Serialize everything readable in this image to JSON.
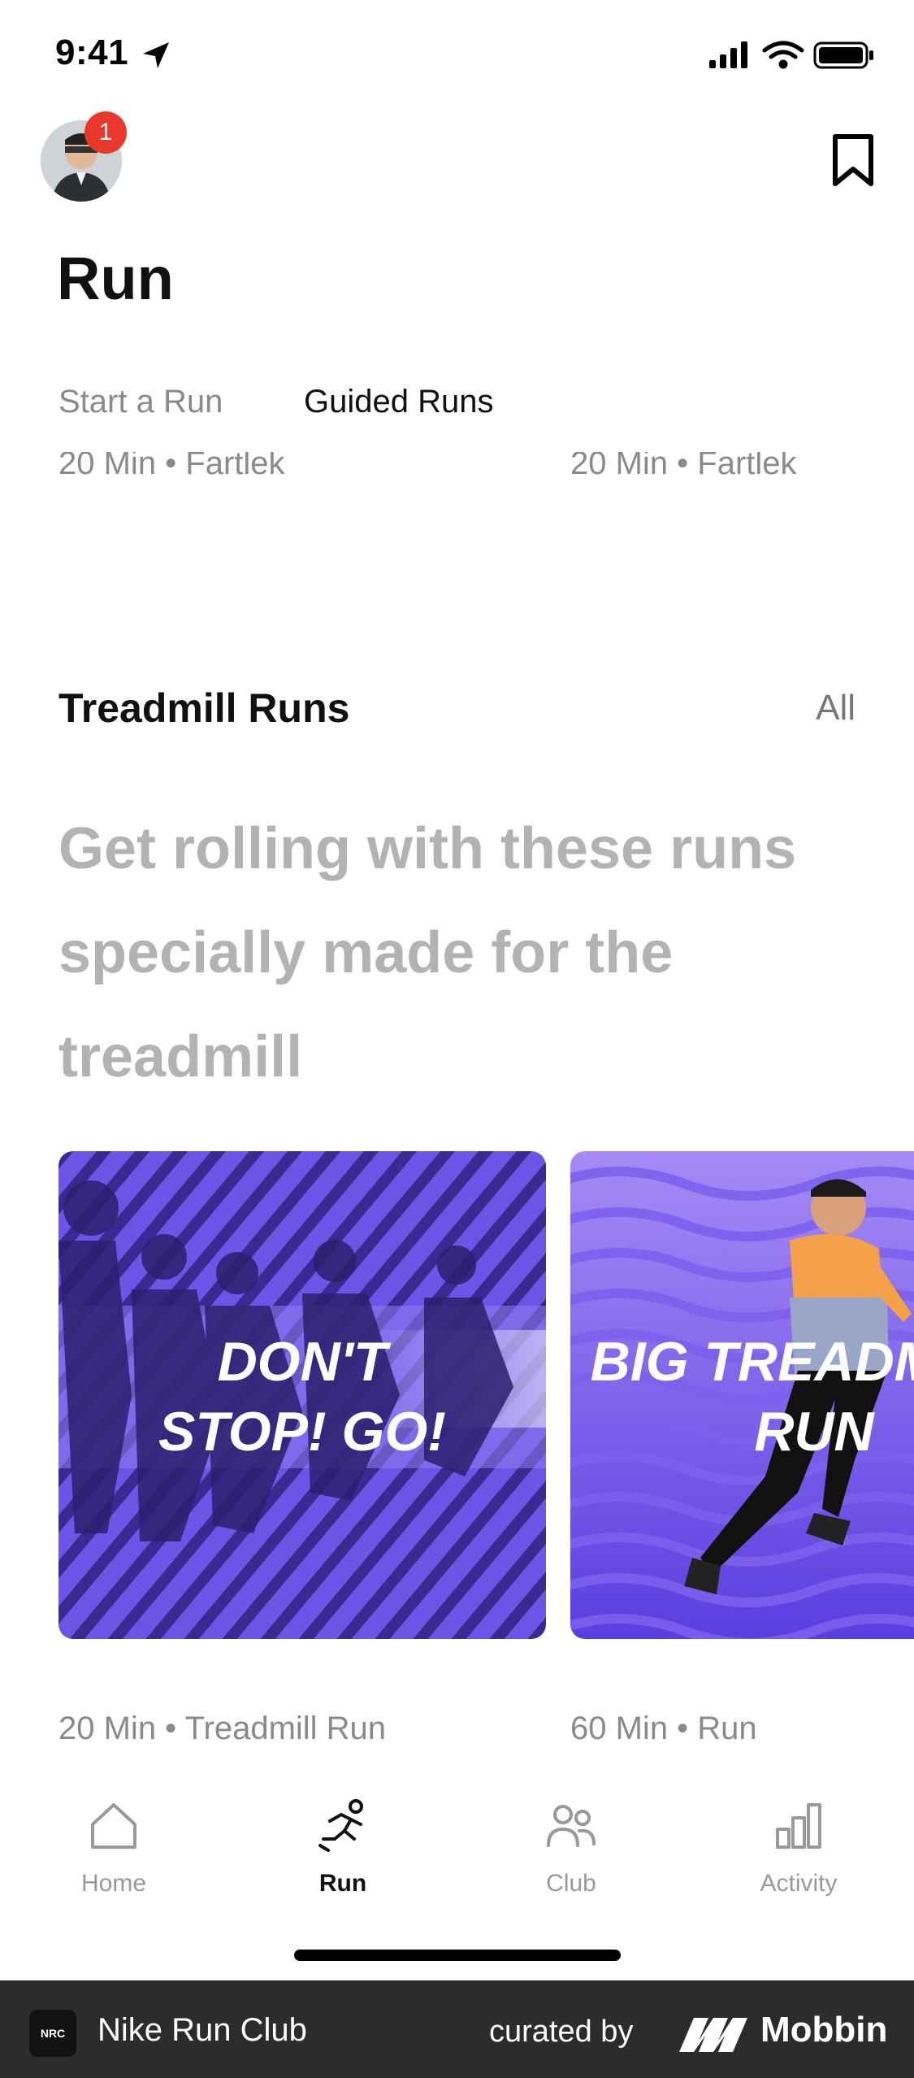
{
  "status_bar": {
    "time": "9:41"
  },
  "header": {
    "notification_count": "1",
    "title": "Run"
  },
  "tabs": [
    {
      "label": "Start a Run",
      "active": false
    },
    {
      "label": "Guided Runs",
      "active": true
    }
  ],
  "previous_section_meta": [
    "20 Min • Fartlek",
    "20 Min • Fartlek"
  ],
  "section": {
    "title": "Treadmill Runs",
    "all_label": "All",
    "description": "Get rolling with these runs specially made for the treadmill"
  },
  "cards": [
    {
      "title_lines": [
        "DON'T",
        "STOP! GO!"
      ],
      "meta": "20 Min • Treadmill Run"
    },
    {
      "title_lines": [
        "BIG TREADM",
        "RUN"
      ],
      "meta": "60 Min • Run"
    }
  ],
  "tab_bar": [
    {
      "label": "Home",
      "icon": "home-icon",
      "active": false
    },
    {
      "label": "Run",
      "icon": "runner-icon",
      "active": true
    },
    {
      "label": "Club",
      "icon": "people-icon",
      "active": false
    },
    {
      "label": "Activity",
      "icon": "bar-chart-icon",
      "active": false
    }
  ],
  "footer": {
    "app_icon_text": "NRC",
    "app_name": "Nike Run Club",
    "curated_by": "curated by",
    "brand": "Mobbin"
  },
  "colors": {
    "accent_purple": "#6a52e8",
    "badge_red": "#e8372b",
    "footer_bg": "#2c2c2e"
  }
}
